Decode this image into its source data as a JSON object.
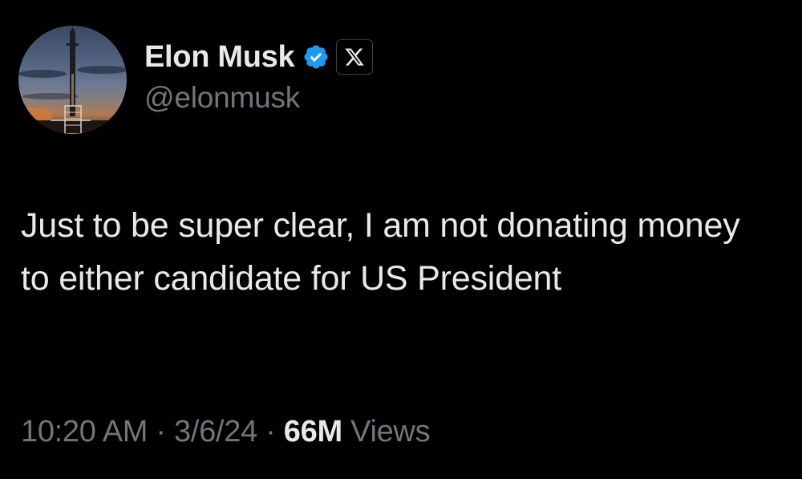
{
  "author": {
    "display_name": "Elon Musk",
    "handle": "@elonmusk",
    "avatar_icon": "rocket-launch-avatar",
    "verified_icon": "verified-badge-icon",
    "affiliation_icon": "x-logo-icon"
  },
  "tweet": {
    "text": "Just to be super clear, I am not donating money to either candidate for US President"
  },
  "meta": {
    "time": "10:20 AM",
    "separator": "·",
    "date": "3/6/24",
    "views_count": "66M",
    "views_label": "Views"
  },
  "colors": {
    "background": "#000000",
    "primary_text": "#e7e9ea",
    "secondary_text": "#71767b",
    "verified_blue": "#1d9bf0"
  }
}
